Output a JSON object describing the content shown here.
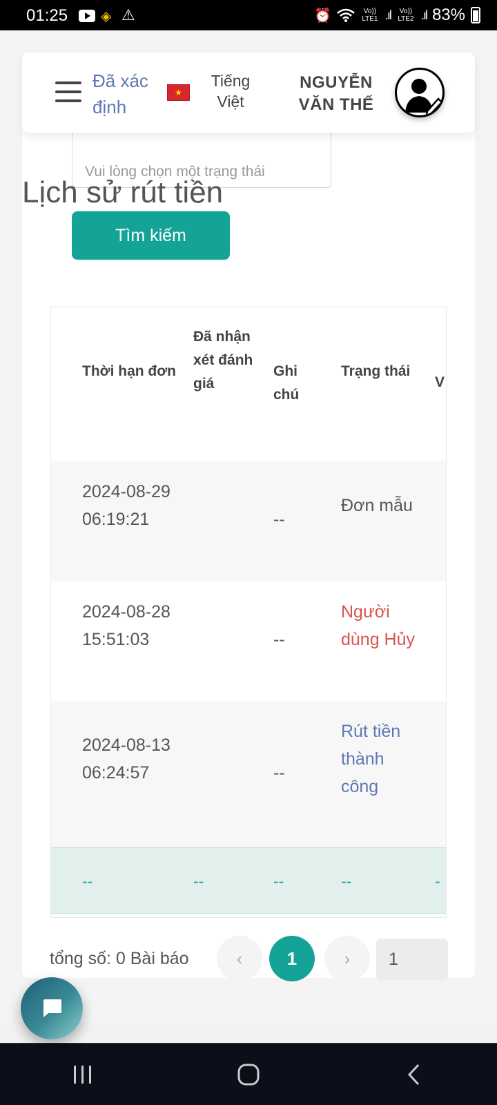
{
  "status_bar": {
    "time": "01:25",
    "sim1": "Vo)) LTE1",
    "sim2": "Vo)) LTE2",
    "battery": "83%",
    "icons": [
      "youtube-icon",
      "binance-icon",
      "warning-icon",
      "alarm-icon",
      "wifi-icon",
      "signal-icon",
      "battery-icon"
    ]
  },
  "header": {
    "verified_label": "Đã xác định",
    "language_label": "Tiếng Việt",
    "username": "NGUYỄN VĂN THẾ"
  },
  "filter": {
    "status_placeholder": "Vui lòng chọn một trạng thái",
    "search_button": "Tìm kiếm"
  },
  "page_title": "Lịch sử rút tiền",
  "table": {
    "columns": [
      "Thời hạn đơn",
      "Đã nhận xét đánh giá",
      "Ghi chú",
      "Trạng thái",
      "V"
    ],
    "rows": [
      {
        "time": "2024-08-29 06:19:21",
        "note": "--",
        "status": "Đơn mẫu",
        "status_color": "#555555"
      },
      {
        "time": "2024-08-28 15:51:03",
        "note": "--",
        "status": "Người dùng Hủy",
        "status_color": "#d9534f"
      },
      {
        "time": "2024-08-13 06:24:57",
        "note": "--",
        "status": "Rút tiền thành công",
        "status_color": "#5f78b4"
      }
    ],
    "summary": [
      "--",
      "--",
      "--",
      "--",
      "-"
    ]
  },
  "pagination": {
    "total_label": "tổng số: 0 Bài báo",
    "prev": "‹",
    "current_page": "1",
    "next": "›",
    "page_input": "1"
  },
  "colors": {
    "accent": "#13a397",
    "verified": "#5f78b4",
    "cancelled": "#d9534f"
  }
}
